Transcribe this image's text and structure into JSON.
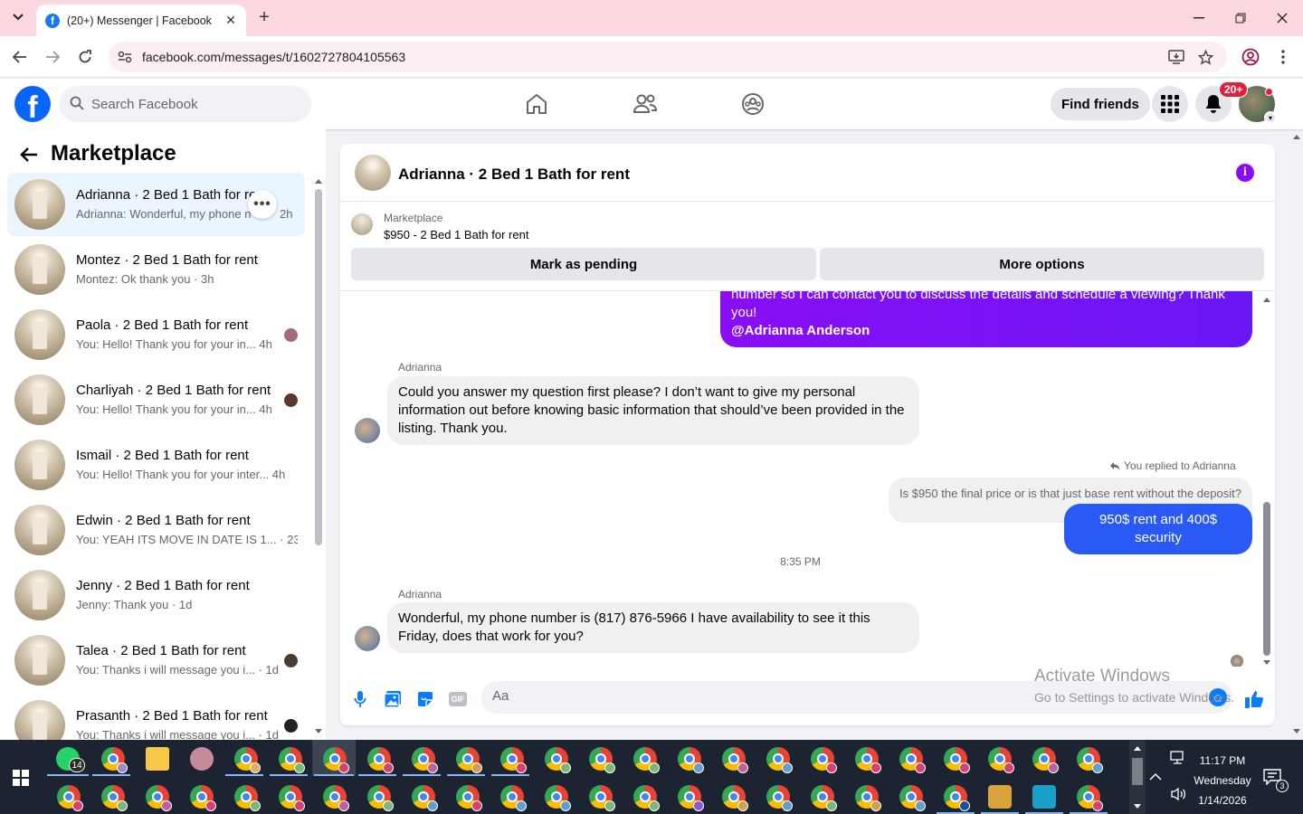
{
  "browser": {
    "tab_title": "(20+) Messenger | Facebook",
    "url": "facebook.com/messages/t/1602727804105563",
    "favicon_letter": "f"
  },
  "facebook": {
    "logo_letter": "f",
    "search_placeholder": "Search Facebook",
    "find_friends": "Find friends",
    "notif_badge": "20+"
  },
  "sidebar": {
    "title": "Marketplace",
    "conversations": [
      {
        "name": "Adrianna · 2 Bed 1 Bath for rent",
        "snippet": "Adrianna: Wonderful, my phone n",
        "time": "2h",
        "active": true
      },
      {
        "name": "Montez · 2 Bed 1 Bath for rent",
        "snippet": "Montez: Ok thank you · 3h"
      },
      {
        "name": "Paola · 2 Bed 1 Bath for rent",
        "snippet": "You: Hello! Thank you for your in...  4h"
      },
      {
        "name": "Charliyah · 2 Bed 1 Bath for rent",
        "snippet": "You: Hello! Thank you for your in...  4h"
      },
      {
        "name": "Ismail · 2 Bed 1 Bath for rent",
        "snippet": "You: Hello! Thank you for your inter...  4h"
      },
      {
        "name": "Edwin · 2 Bed 1 Bath for rent",
        "snippet": "You: YEAH ITS MOVE IN DATE IS 1... · 23h"
      },
      {
        "name": "Jenny · 2 Bed 1 Bath for rent",
        "snippet": "Jenny: Thank you · 1d"
      },
      {
        "name": "Talea · 2 Bed 1 Bath for rent",
        "snippet": "You: Thanks i will message you i... · 1d"
      },
      {
        "name": "Prasanth · 2 Bed 1 Bath for rent",
        "snippet": "You: Thanks i will message you i... · 1d"
      }
    ]
  },
  "chat": {
    "title": "Adrianna · 2 Bed 1 Bath for rent",
    "info_icon": "i",
    "listing_label": "Marketplace",
    "listing_price": "$950 - 2 Bed 1 Bath for rent",
    "btn_pending": "Mark as pending",
    "btn_more": "More options",
    "out_msg_line1": "number so I can contact you to discuss the details and schedule a viewing? Thank",
    "out_msg_line2": "you!",
    "out_msg_mention": "@Adrianna Anderson",
    "sender1": "Adrianna",
    "in_msg1": "Could you answer my question first please? I don’t want to give my personal information out before knowing basic information that should’ve been provided in the listing. Thank you.",
    "replied_label": "You replied to Adrianna",
    "quoted": "Is $950 the final price or is that just base rent without the deposit?",
    "reply_msg": "950$ rent and 400$ security",
    "timestamp": "8:35 PM",
    "sender2": "Adrianna",
    "in_msg2": "Wonderful, my phone number is (817) 876-5966 I have availability to see it this Friday, does that work for you?",
    "composer_placeholder": "Aa",
    "gif_label": "GIF"
  },
  "watermark": {
    "line1": "Activate Windows",
    "line2": "Go to Settings to activate Windows."
  },
  "taskbar": {
    "whatsapp_badge": "14",
    "time": "11:17 PM",
    "day": "Wednesday",
    "date": "1/14/2026",
    "notif_count": "3"
  }
}
